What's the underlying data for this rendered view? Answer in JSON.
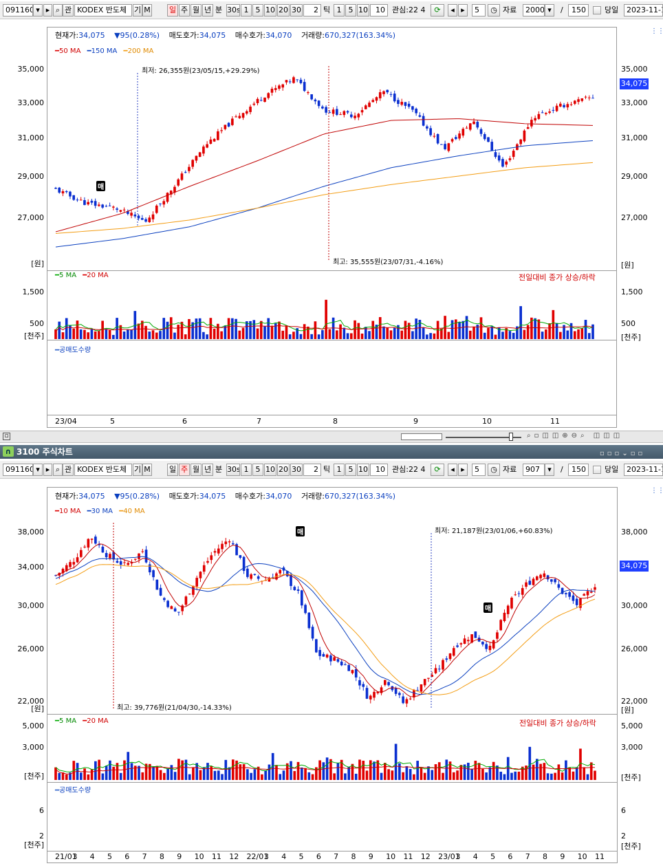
{
  "toolbar": {
    "code": "091160",
    "name": "KODEX 반도체",
    "gi": "기",
    "m": "M",
    "periods": [
      "일",
      "주",
      "월",
      "년"
    ],
    "bun": "분",
    "s30": "30s",
    "mins": [
      "1",
      "5",
      "10",
      "20",
      "30"
    ],
    "tick_val": "2",
    "tick": "틱",
    "ticks": [
      "1",
      "5",
      "10"
    ],
    "tick_input": "10",
    "gwansim": "관심:22 4",
    "step": "5",
    "jaryo": "자료",
    "count_top": "2000",
    "count_bottom": "907",
    "slash": "/",
    "view": "150",
    "dangil": "당일",
    "date": "2023-11-1",
    "chan": "관"
  },
  "top": {
    "info": {
      "cur_label": "현재가:",
      "cur": "34,075",
      "chg": "▼95(0.28%)",
      "ask_label": "매도호가:",
      "ask": "34,075",
      "bid_label": "매수호가:",
      "bid": "34,070",
      "vol_label": "거래량:",
      "vol": "670,327(163.34%)"
    },
    "legend": [
      "50 MA",
      "150 MA",
      "200 MA"
    ],
    "y_ticks": [
      "35,000",
      "33,000",
      "31,000",
      "29,000",
      "27,000"
    ],
    "unit": "[원]",
    "price": "34,075",
    "low_ann": "최저: 26,355원(23/05/15,+29.29%)",
    "high_ann": "최고: 35,555원(23/07/31,-4.16%)",
    "vol_legend": [
      "5 MA",
      "20 MA"
    ],
    "vol_note": "전일대비 종가 상승/하락",
    "vol_ticks": [
      "1,500",
      "500"
    ],
    "vol_unit": "[천주]",
    "short_legend": "공매도수량",
    "x_ticks": [
      "23/04",
      "5",
      "6",
      "7",
      "8",
      "9",
      "10",
      "11"
    ],
    "badge": "매"
  },
  "title": "3100 주식차트",
  "bottom": {
    "info": {
      "cur_label": "현재가:",
      "cur": "34,075",
      "chg": "▼95(0.28%)",
      "ask_label": "매도호가:",
      "ask": "34,075",
      "bid_label": "매수호가:",
      "bid": "34,070",
      "vol_label": "거래량:",
      "vol": "670,327(163.34%)"
    },
    "legend": [
      "10 MA",
      "30 MA",
      "40 MA"
    ],
    "y_ticks": [
      "38,000",
      "34,000",
      "30,000",
      "26,000",
      "22,000"
    ],
    "unit": "[원]",
    "price": "34,075",
    "low_ann": "최저: 21,187원(23/01/06,+60.83%)",
    "high_ann": "최고: 39,776원(21/04/30,-14.33%)",
    "vol_legend": [
      "5 MA",
      "20 MA"
    ],
    "vol_note": "전일대비 종가 상승/하락",
    "vol_ticks": [
      "5,000",
      "3,000"
    ],
    "vol_unit": "[천주]",
    "short_legend": "공매도수량",
    "short_ticks": [
      "6",
      "2"
    ],
    "x_ticks": [
      "21/01",
      "3",
      "4",
      "5",
      "6",
      "7",
      "8",
      "9",
      "10",
      "11",
      "12",
      "22/01",
      "3",
      "4",
      "5",
      "6",
      "7",
      "8",
      "9",
      "10",
      "11",
      "12",
      "23/01",
      "3",
      "4",
      "5",
      "6",
      "7",
      "8",
      "9",
      "10",
      "11"
    ],
    "badge": "매"
  },
  "chart_data": [
    {
      "type": "candlestick",
      "period": "daily",
      "ylim": [
        25000,
        36000
      ],
      "last": 34075,
      "low": {
        "value": 26355,
        "date": "23/05/15"
      },
      "high": {
        "value": 35555,
        "date": "23/07/31"
      },
      "ma": {
        "50": [
          26100,
          27200,
          28800,
          30300,
          31900,
          32700,
          32800,
          32500,
          32400
        ],
        "150": [
          25200,
          25700,
          26400,
          27500,
          28800,
          29900,
          30600,
          31200,
          31500
        ],
        "200": [
          26000,
          26300,
          26800,
          27500,
          28300,
          28900,
          29400,
          29900,
          30200
        ]
      },
      "close": [
        28600,
        27800,
        27500,
        26700,
        28900,
        31200,
        32800,
        34200,
        35200,
        33300,
        33000,
        34400,
        33200,
        31000,
        32700,
        29900,
        32900,
        33600,
        34075
      ]
    },
    {
      "type": "candlestick",
      "period": "weekly",
      "ylim": [
        21500,
        40500
      ],
      "last": 34075,
      "low": {
        "value": 21187,
        "date": "23/01/06"
      },
      "high": {
        "value": 39776,
        "date": "21/04/30"
      },
      "close": [
        35000,
        36500,
        39000,
        37000,
        36000,
        37500,
        33000,
        31000,
        34500,
        37200,
        38800,
        35000,
        34500,
        35500,
        33000,
        27000,
        26500,
        25500,
        22500,
        24500,
        22000,
        24000,
        25500,
        28000,
        29000,
        27500,
        32000,
        34000,
        35500,
        33500,
        32000,
        34075
      ]
    }
  ]
}
